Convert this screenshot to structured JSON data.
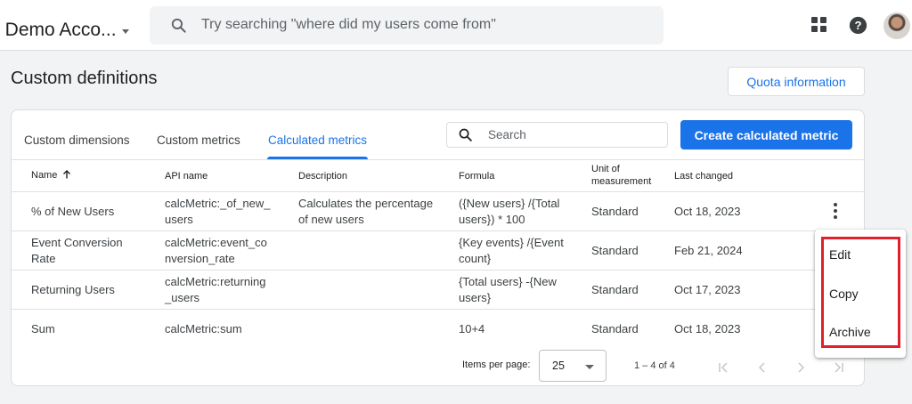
{
  "header": {
    "account_name": "t Demo Acco...",
    "search_placeholder": "Try searching \"where did my users come from\"",
    "icons": [
      "search-icon",
      "apps-icon",
      "help-icon",
      "avatar"
    ]
  },
  "page": {
    "title": "Custom definitions",
    "quota_button": "Quota information"
  },
  "tabs": [
    {
      "label": "Custom dimensions",
      "active": false
    },
    {
      "label": "Custom metrics",
      "active": false
    },
    {
      "label": "Calculated metrics",
      "active": true
    }
  ],
  "toolbar": {
    "search_placeholder": "Search",
    "create_button": "Create calculated metric"
  },
  "table": {
    "headers": {
      "name": "Name",
      "api_name": "API name",
      "description": "Description",
      "formula": "Formula",
      "unit_l1": "Unit of",
      "unit_l2": "measurement",
      "last_changed": "Last changed"
    },
    "rows": [
      {
        "name": [
          "% of New Users"
        ],
        "api": [
          "calcMetric:_of_new_",
          "users"
        ],
        "desc": [
          "Calculates the percentage",
          "of new users"
        ],
        "formula": [
          "({New users} /{Total",
          "users}) * 100"
        ],
        "unit": "Standard",
        "changed": "Oct 18, 2023"
      },
      {
        "name": [
          "Event Conversion",
          "Rate"
        ],
        "api": [
          "calcMetric:event_co",
          "nversion_rate"
        ],
        "desc": [],
        "formula": [
          "{Key events} /{Event",
          "count}"
        ],
        "unit": "Standard",
        "changed": "Feb 21, 2024"
      },
      {
        "name": [
          "Returning Users"
        ],
        "api": [
          "calcMetric:returning",
          "_users"
        ],
        "desc": [],
        "formula": [
          "{Total users} -{New",
          "users}"
        ],
        "unit": "Standard",
        "changed": "Oct 17, 2023"
      },
      {
        "name": [
          "Sum"
        ],
        "api": [
          "calcMetric:sum"
        ],
        "desc": [],
        "formula": [
          "10+4"
        ],
        "unit": "Standard",
        "changed": "Oct 18, 2023"
      }
    ]
  },
  "pagination": {
    "items_per_page_label": "Items per page:",
    "items_per_page": "25",
    "range": "1 – 4 of 4"
  },
  "context_menu": {
    "items": [
      "Edit",
      "Copy",
      "Archive"
    ],
    "highlight_color": "#e0202a"
  },
  "colors": {
    "accent": "#1a73e8"
  }
}
